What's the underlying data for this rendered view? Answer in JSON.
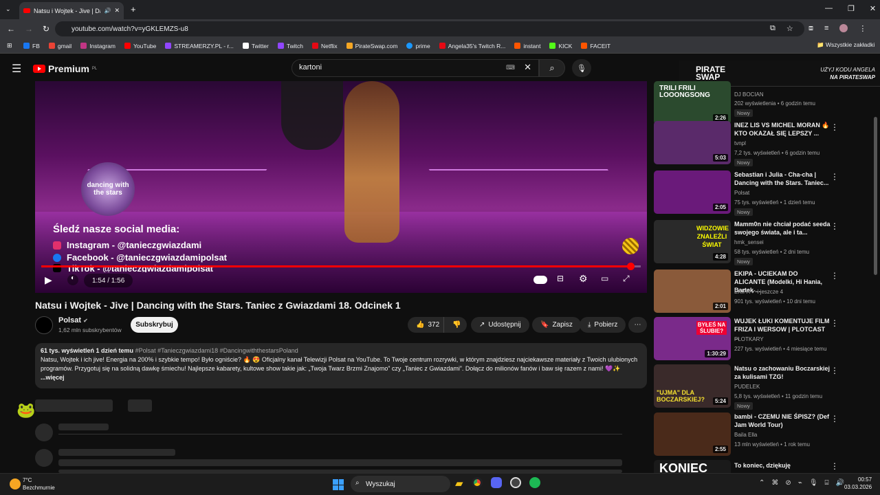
{
  "browser": {
    "tab_title": "Natsu i Wojtek - Jive | Danc",
    "url": "youtube.com/watch?v=yGKLEMZS-u8",
    "bookmarks": [
      {
        "label": "FB",
        "color": "#1877f2"
      },
      {
        "label": "gmail",
        "color": "#ea4335"
      },
      {
        "label": "Instagram",
        "color": "#c13584"
      },
      {
        "label": "YouTube",
        "color": "#ff0000"
      },
      {
        "label": "STREAMERZY.PL - r...",
        "color": "#9146ff"
      },
      {
        "label": "Twitter",
        "color": "#ffffff"
      },
      {
        "label": "Twitch",
        "color": "#9146ff"
      },
      {
        "label": "Netflix",
        "color": "#e50914"
      },
      {
        "label": "PirateSwap.com",
        "color": "#f5a623"
      },
      {
        "label": "prime",
        "color": "#1a98ff"
      },
      {
        "label": "Angela35's Twitch R...",
        "color": "#e50914"
      },
      {
        "label": "instant",
        "color": "#ff5500"
      },
      {
        "label": "KICK",
        "color": "#53fc18"
      },
      {
        "label": "FACEIT",
        "color": "#ff5500"
      }
    ],
    "all_bookmarks": "Wszystkie zakładki"
  },
  "header": {
    "logo": "Premium",
    "logo_sup": "PL",
    "search_value": "kartoni"
  },
  "ad": {
    "brand": "PIRATE SWAP",
    "text1": "UŻYJ KODU ANGELA",
    "text2": "NA PIRATESWAP"
  },
  "player": {
    "overlay_heading": "Śledź nasze social media:",
    "overlay_lines": [
      {
        "label": "Instagram - @tanieczgwiazdami",
        "color": "#e1306c"
      },
      {
        "label": "Facebook - @tanieczgwiazdamipolsat",
        "color": "#1877f2"
      },
      {
        "label": "TikTok - @tanieczgwiazdamipolsat",
        "color": "#000000"
      }
    ],
    "logo_text": "dancing with the stars",
    "time": "1:54 / 1:56",
    "progress": 0.983
  },
  "video": {
    "title": "Natsu i Wojtek - Jive | Dancing with the Stars. Taniec z Gwiazdami 18. Odcinek 1",
    "channel": "Polsat",
    "subscribers": "1,62 mln subskrybentów",
    "subscribe_label": "Subskrybuj",
    "likes": "372",
    "share": "Udostępnij",
    "save": "Zapisz",
    "download": "Pobierz",
    "desc_meta": "61 tys. wyświetleń  1 dzień temu",
    "desc_tags": "#Polsat #Tanieczgwiazdami18 #DancingwiththestarsPoland",
    "desc_text": "Natsu, Wojtek i ich jive! Energia na 200% i szybkie tempo! Było ogniście? 🔥 😍 Oficjalny kanał Telewizji Polsat na YouTube. To Twoje centrum rozrywki, w którym znajdziesz najciekawsze materiały z Twoich ulubionych programów. Przygotuj się na solidną dawkę śmiechu! Najlepsze kabarety, kultowe show takie jak: „Twoja Twarz Brzmi Znajomo” czy „Taniec z Gwiazdami”. Dołącz do milionów fanów i baw się razem z nami! 💜✨",
    "desc_more": "...więcej"
  },
  "sidebar": [
    {
      "title": "",
      "channel": "DJ BOCIAN",
      "views": "202 wyświetlenia • 6 godzin temu",
      "badge": "Nowy",
      "duration": "2:26",
      "color": "#2b4a2e",
      "thumb_text": "TRILI FRILI LOOONGSONG"
    },
    {
      "title": "INEZ LIS VS MICHEL MORAN 🔥 KTO OKAZAŁ SIĘ LEPSZY ...",
      "channel": "tvnpl",
      "views": "7,2 tys. wyświetleń • 6 godzin temu",
      "badge": "Nowy",
      "duration": "5:03",
      "color": "#5a2a6a",
      "thumb_text": ""
    },
    {
      "title": "Sebastian i Julia - Cha-cha | Dancing with the Stars. Taniec...",
      "channel": "Polsat",
      "views": "75 tys. wyświetleń • 1 dzień temu",
      "badge": "Nowy",
      "duration": "2:05",
      "color": "#6a1a7a",
      "thumb_text": ""
    },
    {
      "title": "Mamm0n nie chciał podać seeda swojego świata, ale i ta...",
      "channel": "hmk_sensei",
      "views": "58 tys. wyświetleń • 2 dni temu",
      "badge": "Nowy",
      "duration": "4:28",
      "color": "#2a2a2a",
      "thumb_text": "WIDZOWIE ZNALEŹLI ŚWIAT"
    },
    {
      "title": "EKIPA - UCIEKAM DO ALICANTE (Modelki, Hi Hania, Bartek ...",
      "channel": "EKIPA ✔ i jeszcze 4",
      "views": "901 tys. wyświetleń • 10 dni temu",
      "badge": "",
      "duration": "2:01",
      "color": "#8a5a3a",
      "thumb_text": ""
    },
    {
      "title": "WUJEK ŁUKI KOMENTUJE FILM FRIZA I WERSOW | PLOTCAST ...",
      "channel": "PLOTKARY",
      "views": "227 tys. wyświetleń • 4 miesiące temu",
      "badge": "",
      "duration": "1:30:29",
      "color": "#7a2a8a",
      "thumb_text": "BYŁEŚ NA ŚLUBIE?"
    },
    {
      "title": "Natsu o zachowaniu Boczarskiej za kulisami TZG!",
      "channel": "PUDELEK",
      "views": "5,8 tys. wyświetleń • 11 godzin temu",
      "badge": "Nowy",
      "duration": "5:24",
      "color": "#3a2a2a",
      "thumb_text": "\"UJMA\" DLA BOCZARSKIEJ?"
    },
    {
      "title": "bambi - CZEMU NIE ŚPISZ? (Def Jam World Tour)",
      "channel": "Baila Ella",
      "views": "13 mln wyświetleń • 1 rok temu",
      "badge": "",
      "duration": "2:55",
      "color": "#4a2a1a",
      "thumb_text": ""
    },
    {
      "title": "To koniec, dziękuję",
      "channel": "",
      "views": "",
      "badge": "",
      "duration": "",
      "color": "#1a1a1a",
      "thumb_text": "KONIEC"
    }
  ],
  "taskbar": {
    "temp": "7°C",
    "weather": "Bezchmurnie",
    "search": "Wyszukaj",
    "time": "00:57",
    "date": "03.03.2026"
  }
}
